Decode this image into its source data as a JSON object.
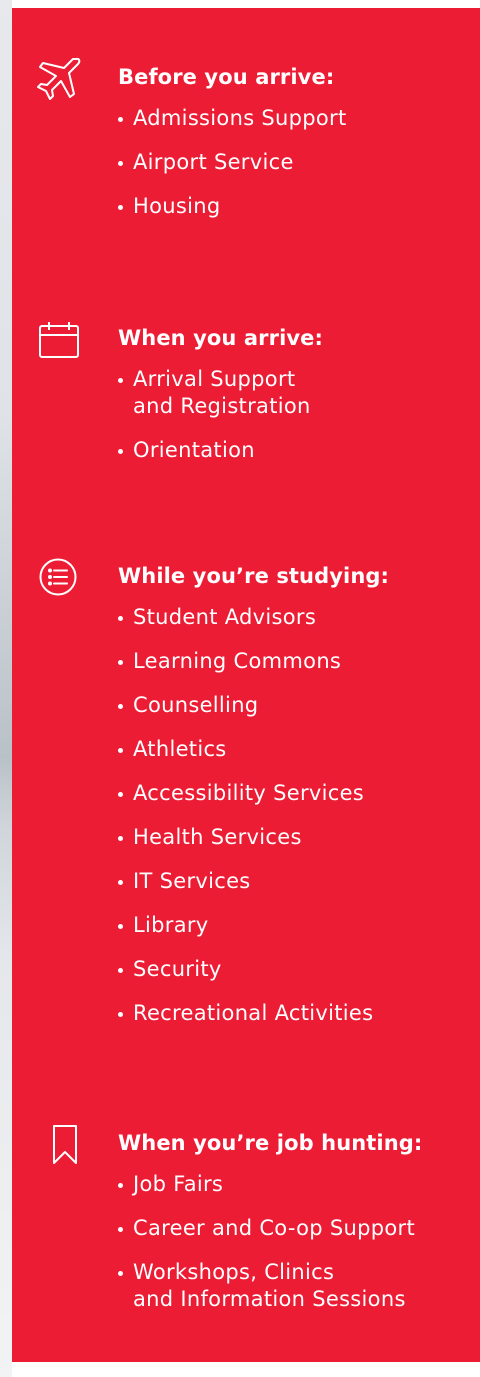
{
  "colors": {
    "panel_background": "#ed1c35",
    "text": "#ffffff"
  },
  "sections": [
    {
      "icon": "airplane-icon",
      "title": "Before you arrive:",
      "items": [
        "Admissions Support",
        "Airport Service",
        "Housing"
      ]
    },
    {
      "icon": "calendar-icon",
      "title": "When you arrive:",
      "items": [
        "Arrival Support\nand Registration",
        "Orientation"
      ]
    },
    {
      "icon": "list-icon",
      "title": "While you’re studying:",
      "items": [
        "Student Advisors",
        "Learning Commons",
        "Counselling",
        "Athletics",
        "Accessibility Services",
        "Health Services",
        "IT Services",
        "Library",
        "Security",
        "Recreational Activities"
      ]
    },
    {
      "icon": "bookmark-icon",
      "title": "When you’re job hunting:",
      "items": [
        "Job Fairs",
        "Career and Co-op Support",
        "Workshops, Clinics\nand Information Sessions"
      ]
    }
  ]
}
